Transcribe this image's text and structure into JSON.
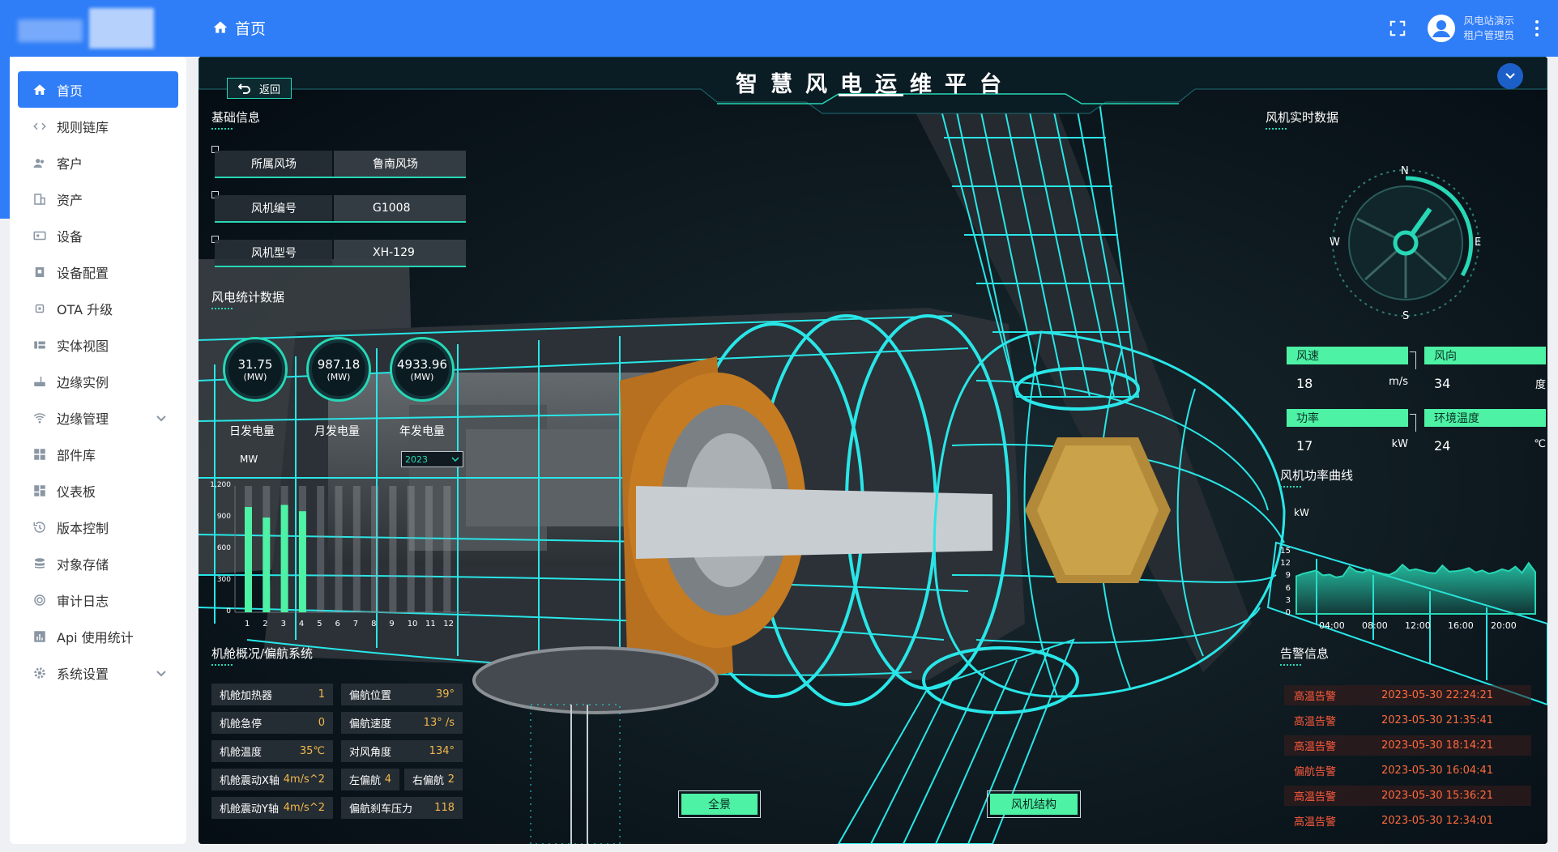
{
  "topbar": {
    "breadcrumb": "首页",
    "user_name": "风电站演示",
    "user_role": "租户管理员"
  },
  "sidebar": {
    "items": [
      {
        "label": "首页",
        "icon": "home-icon",
        "active": true
      },
      {
        "label": "规则链库",
        "icon": "code-icon"
      },
      {
        "label": "客户",
        "icon": "users-icon"
      },
      {
        "label": "资产",
        "icon": "building-icon"
      },
      {
        "label": "设备",
        "icon": "device-icon"
      },
      {
        "label": "设备配置",
        "icon": "device-profile-icon"
      },
      {
        "label": "OTA 升级",
        "icon": "chip-icon"
      },
      {
        "label": "实体视图",
        "icon": "view-icon"
      },
      {
        "label": "边缘实例",
        "icon": "router-icon"
      },
      {
        "label": "边缘管理",
        "icon": "wifi-icon",
        "expandable": true
      },
      {
        "label": "部件库",
        "icon": "widgets-icon"
      },
      {
        "label": "仪表板",
        "icon": "dashboard-icon"
      },
      {
        "label": "版本控制",
        "icon": "history-icon"
      },
      {
        "label": "对象存储",
        "icon": "storage-icon"
      },
      {
        "label": "审计日志",
        "icon": "audit-icon"
      },
      {
        "label": "Api 使用统计",
        "icon": "chart-icon"
      },
      {
        "label": "系统设置",
        "icon": "gear-icon",
        "expandable": true
      }
    ]
  },
  "dashboard": {
    "title": "智慧风电运维平台",
    "back_label": "返回",
    "basic_info": {
      "title": "基础信息",
      "rows": [
        {
          "key": "所属风场",
          "value": "鲁南风场"
        },
        {
          "key": "风机编号",
          "value": "G1008"
        },
        {
          "key": "风机型号",
          "value": "XH-129"
        }
      ]
    },
    "stats": {
      "title": "风电统计数据",
      "gauges": [
        {
          "value": "31.75",
          "unit": "(MW)",
          "label": "日发电量"
        },
        {
          "value": "987.18",
          "unit": "(MW)",
          "label": "月发电量"
        },
        {
          "value": "4933.96",
          "unit": "(MW)",
          "label": "年发电量"
        }
      ],
      "year_selected": "2023",
      "unit": "MW"
    },
    "nacelle": {
      "title": "机舱概况/偏航系统",
      "left": [
        {
          "key": "机舱加热器",
          "value": "1"
        },
        {
          "key": "机舱急停",
          "value": "0"
        },
        {
          "key": "机舱温度",
          "value": "35℃"
        },
        {
          "key": "机舱震动X轴",
          "value": "4m/s^2"
        },
        {
          "key": "机舱震动Y轴",
          "value": "4m/s^2"
        }
      ],
      "right": [
        {
          "key": "偏航位置",
          "value": "39°"
        },
        {
          "key": "偏航速度",
          "value": "13° /s"
        },
        {
          "key": "对风角度",
          "value": "134°"
        },
        {
          "key": "左偏航",
          "value": "4"
        },
        {
          "key": "右偏航",
          "value": "2"
        },
        {
          "key": "偏航刹车压力",
          "value": "118"
        }
      ]
    },
    "realtime": {
      "title": "风机实时数据",
      "compass": {
        "n": "N",
        "s": "S",
        "e": "E",
        "w": "W"
      },
      "cards": [
        {
          "label": "风速",
          "value": "18",
          "unit": "m/s"
        },
        {
          "label": "风向",
          "value": "34",
          "unit": "度"
        },
        {
          "label": "功率",
          "value": "17",
          "unit": "kW"
        },
        {
          "label": "环境温度",
          "value": "24",
          "unit": "℃"
        }
      ]
    },
    "power_curve": {
      "title": "风机功率曲线"
    },
    "alarms": {
      "title": "告警信息",
      "rows": [
        {
          "type": "高温告警",
          "date": "2023-05-30 22:24:21"
        },
        {
          "type": "高温告警",
          "date": "2023-05-30 21:35:41"
        },
        {
          "type": "高温告警",
          "date": "2023-05-30 18:14:21"
        },
        {
          "type": "偏航告警",
          "date": "2023-05-30 16:04:41"
        },
        {
          "type": "高温告警",
          "date": "2023-05-30 15:36:21"
        },
        {
          "type": "高温告警",
          "date": "2023-05-30 12:34:01"
        }
      ]
    },
    "buttons": {
      "panorama": "全景",
      "structure": "风机结构"
    },
    "colors": {
      "accent": "#27d7b5",
      "bar": "#4ef2a5",
      "alarm": "#ff5a3c",
      "primary": "#2f7df7"
    }
  },
  "chart_data": [
    {
      "type": "bar",
      "categories": [
        "1",
        "2",
        "3",
        "4",
        "5",
        "6",
        "7",
        "8",
        "9",
        "10",
        "11",
        "12"
      ],
      "values": [
        1000,
        900,
        1020,
        960,
        0,
        0,
        0,
        0,
        0,
        0,
        0,
        0
      ],
      "ylabel": "MW",
      "ylim": [
        0,
        1200
      ],
      "yticks": [
        "0",
        "300",
        "600",
        "900",
        "1,200"
      ]
    },
    {
      "type": "area",
      "x": [
        "04:00",
        "08:00",
        "12:00",
        "16:00",
        "20:00"
      ],
      "ylabel": "kW",
      "ylim": [
        0,
        15
      ],
      "yticks": [
        "0",
        "3",
        "6",
        "9",
        "12",
        "15"
      ],
      "values": [
        9.2,
        9.8,
        10.2,
        10.6,
        9.4,
        9.6,
        8.9,
        9.2,
        11.5,
        10.4,
        10.1,
        10.8,
        10.2,
        9.8,
        9.5,
        10.3,
        12.0,
        10.6,
        10.9,
        10.5,
        10.0,
        9.9,
        11.8,
        10.3,
        10.4,
        10.7,
        11.2,
        10.1,
        10.6,
        9.8,
        10.2,
        10.9,
        10.4,
        11.5,
        10.0,
        12.4,
        10.2
      ]
    }
  ]
}
